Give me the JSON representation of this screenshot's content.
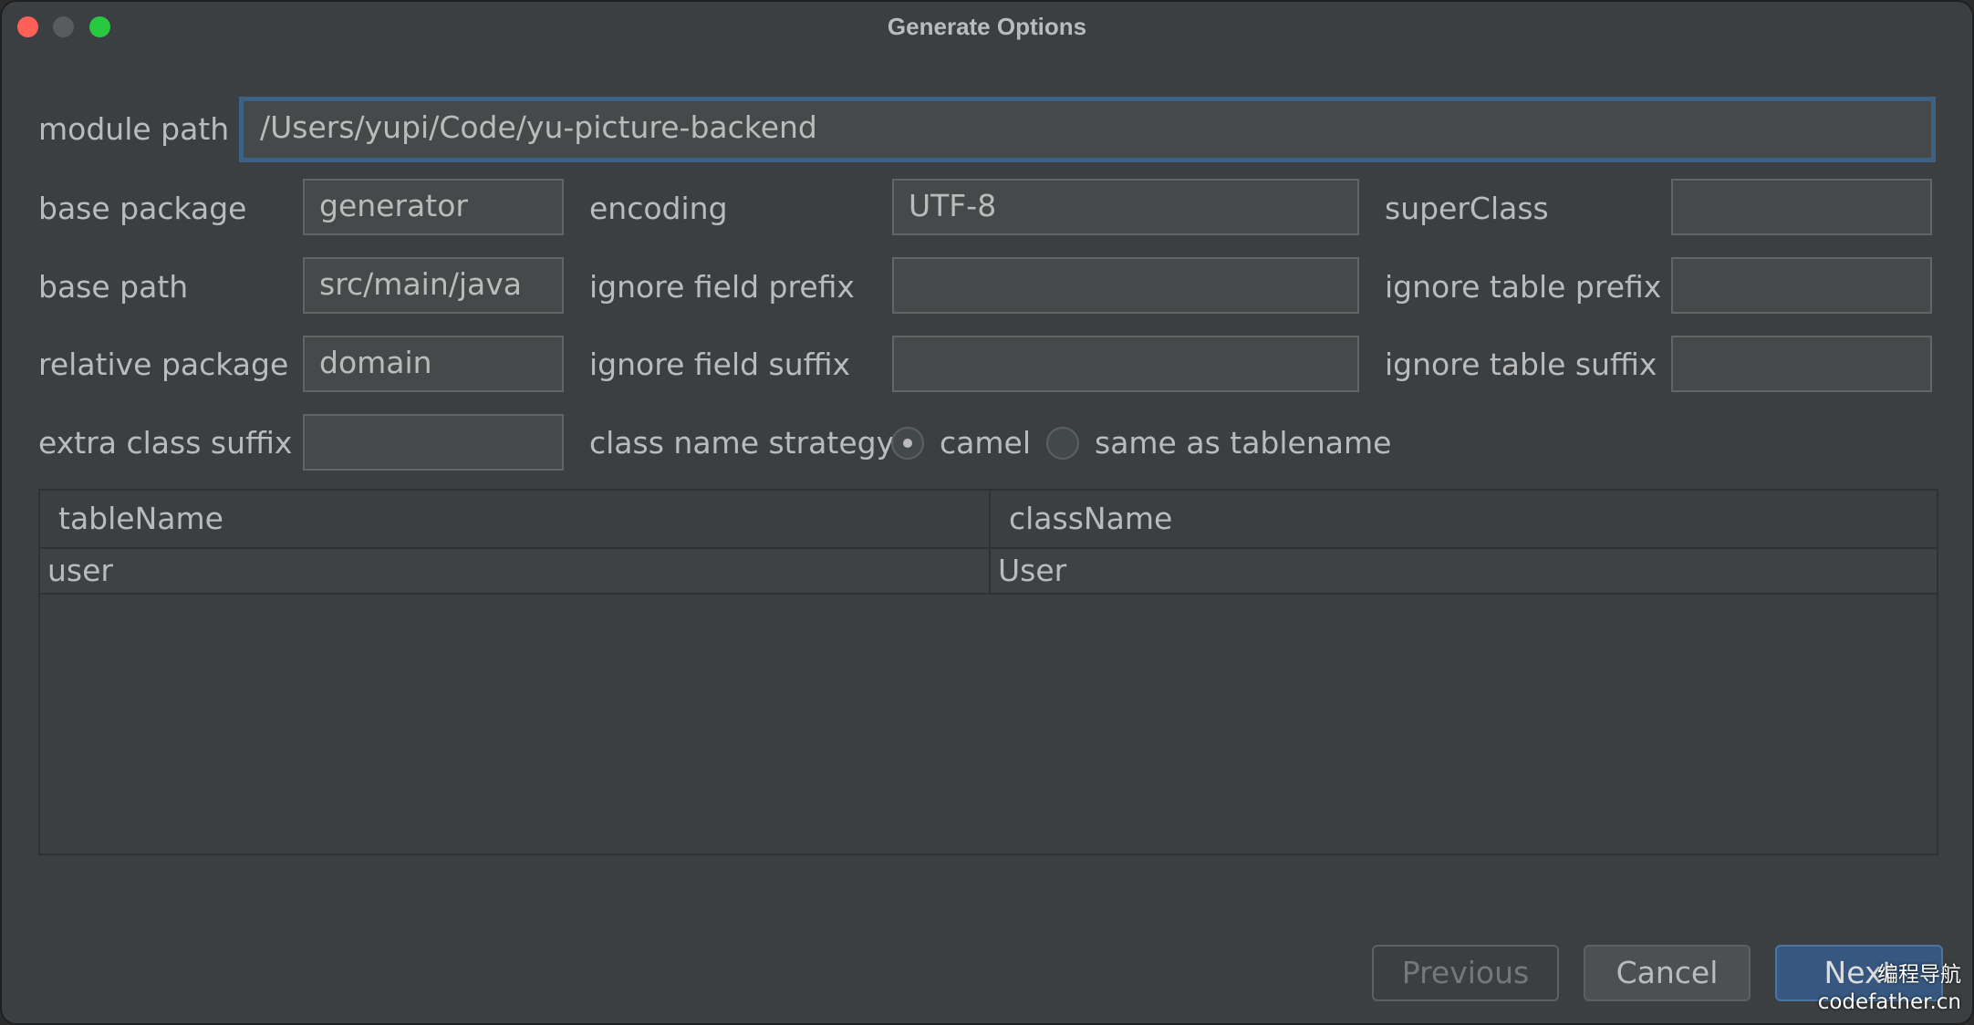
{
  "window": {
    "title": "Generate Options"
  },
  "form": {
    "module_path": {
      "label": "module path",
      "value": "/Users/yupi/Code/yu-picture-backend"
    },
    "base_package": {
      "label": "base package",
      "value": "generator"
    },
    "encoding": {
      "label": "encoding",
      "value": "UTF-8"
    },
    "super_class": {
      "label": "superClass",
      "value": ""
    },
    "base_path": {
      "label": "base path",
      "value": "src/main/java"
    },
    "ignore_field_prefix": {
      "label": "ignore field prefix",
      "value": ""
    },
    "ignore_table_prefix": {
      "label": "ignore table prefix",
      "value": ""
    },
    "relative_package": {
      "label": "relative package",
      "value": "domain"
    },
    "ignore_field_suffix": {
      "label": "ignore field suffix",
      "value": ""
    },
    "ignore_table_suffix": {
      "label": "ignore table suffix",
      "value": ""
    },
    "extra_class_suffix": {
      "label": "extra class suffix",
      "value": ""
    },
    "class_name_strategy": {
      "label": "class name strategy",
      "options": [
        "camel",
        "same as tablename"
      ],
      "selected": "camel"
    }
  },
  "table": {
    "columns": [
      "tableName",
      "className"
    ],
    "rows": [
      [
        "user",
        "User"
      ]
    ]
  },
  "buttons": {
    "previous": "Previous",
    "cancel": "Cancel",
    "next": "Next"
  },
  "watermark": {
    "line1": "编程导航",
    "line2": "codefather.cn"
  },
  "colors": {
    "background": "#3c3f41",
    "field": "#45494a",
    "focus_border": "#3d6185",
    "primary_button": "#365880",
    "close": "#ff5f57",
    "maximize": "#28c840"
  }
}
